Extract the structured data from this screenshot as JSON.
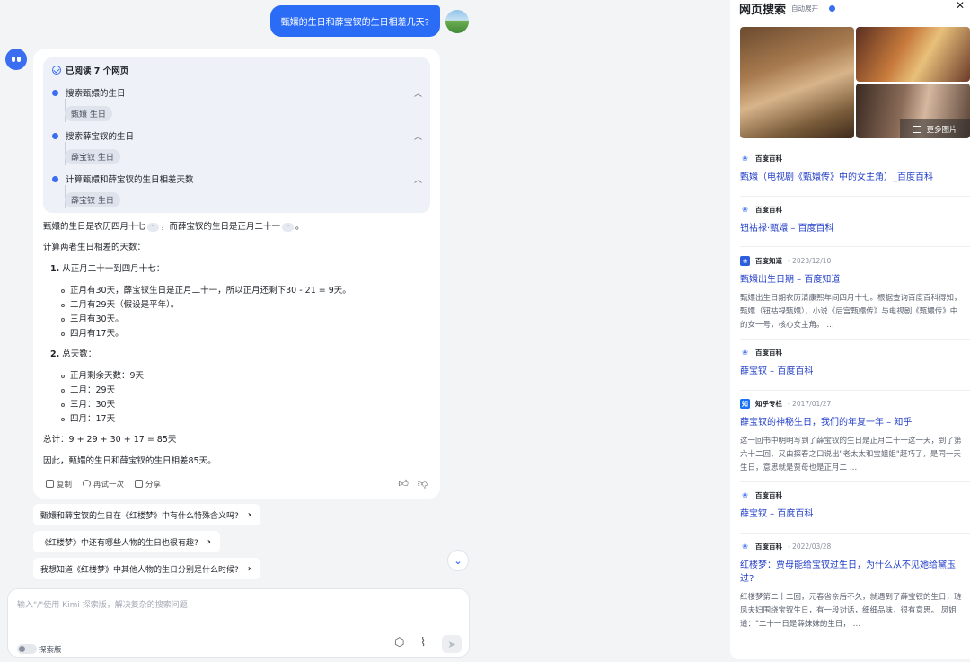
{
  "chat": {
    "user_question": "甄嬛的生日和薛宝钗的生日相差几天?",
    "reading": {
      "title": "已阅读 7 个网页",
      "steps": [
        {
          "label": "搜索甄嬛的生日",
          "chip": "甄嬛 生日"
        },
        {
          "label": "搜索薛宝钗的生日",
          "chip": "薛宝钗 生日"
        },
        {
          "label": "计算甄嬛和薛宝钗的生日相差天数",
          "chip": "薛宝钗 生日"
        }
      ]
    },
    "answer": {
      "intro_a": "甄嬛的生日是农历四月十七",
      "intro_b": "，而薛宝钗的生日是正月二十一",
      "intro_c": "。",
      "cite_mark": "\"",
      "line2": "计算两者生日相差的天数：",
      "step1_num": "1.",
      "step1": "从正月二十一到四月十七：",
      "step1_items": [
        "正月有30天，薛宝钗生日是正月二十一，所以正月还剩下30 - 21 = 9天。",
        "二月有29天（假设是平年）。",
        "三月有30天。",
        "四月有17天。"
      ],
      "step2_num": "2.",
      "step2": "总天数：",
      "step2_items": [
        "正月剩余天数：9天",
        "二月：29天",
        "三月：30天",
        "四月：17天"
      ],
      "total": "总计：9 + 29 + 30 + 17 = 85天",
      "conclusion": "因此，甄嬛的生日和薛宝钗的生日相差85天。"
    },
    "actions": {
      "copy": "复制",
      "retry": "再试一次",
      "share": "分享"
    },
    "suggestions": [
      "甄嬛和薛宝钗的生日在《红楼梦》中有什么特殊含义吗?",
      "《红楼梦》中还有哪些人物的生日也很有趣?",
      "我想知道《红楼梦》中其他人物的生日分别是什么时候?"
    ],
    "composer": {
      "placeholder": "输入\"/\"使用 Kimi 探索版，解决复杂的搜索问题",
      "mode_label": "探索版"
    }
  },
  "web": {
    "title": "网页搜索",
    "auto_expand": "自动展开",
    "more_images": "更多图片",
    "results": [
      {
        "source": "百度百科",
        "date": "",
        "title": "甄嬛（电视剧《甄嬛传》中的女主角）_百度百科",
        "snippet": ""
      },
      {
        "source": "百度百科",
        "date": "",
        "title": "钮祜禄·甄嬛 – 百度百科",
        "snippet": ""
      },
      {
        "source": "百度知道",
        "date": " - 2023/12/10",
        "title": "甄嬛出生日期 – 百度知道",
        "snippet": "甄嬛出生日期农历清康熙年间四月十七。根据查询百度百科得知，甄嬛（钮祜禄甄嬛），小说《后宫甄嬛传》与电视剧《甄嬛传》中的女一号，核心女主角。 …"
      },
      {
        "source": "百度百科",
        "date": "",
        "title": "薛宝钗 – 百度百科",
        "snippet": ""
      },
      {
        "source": "知乎专栏",
        "date": " - 2017/01/27",
        "title": "薛宝钗的神秘生日，我们的年复一年 – 知乎",
        "snippet": "这一回书中明明写到了薛宝钗的生日是正月二十一这一天，到了第六十二回，又由探春之口说出\"老太太和宝姐姐\"赶巧了，是同一天生日，意思就是贾母也是正月二 …"
      },
      {
        "source": "百度百科",
        "date": "",
        "title": "薛宝钗 – 百度百科",
        "snippet": ""
      },
      {
        "source": "百度百科",
        "date": " - 2022/03/28",
        "title": "红楼梦：贾母能给宝钗过生日，为什么从不见她给黛玉过?",
        "snippet": "红楼梦第二十二回，元春省亲后不久，就遇到了薛宝钗的生日，琏凤夫妇围绕宝钗生日，有一段对话，细细品味，很有意思。 凤姐道：\"二十一日是薛妹妹的生日， …"
      }
    ]
  }
}
